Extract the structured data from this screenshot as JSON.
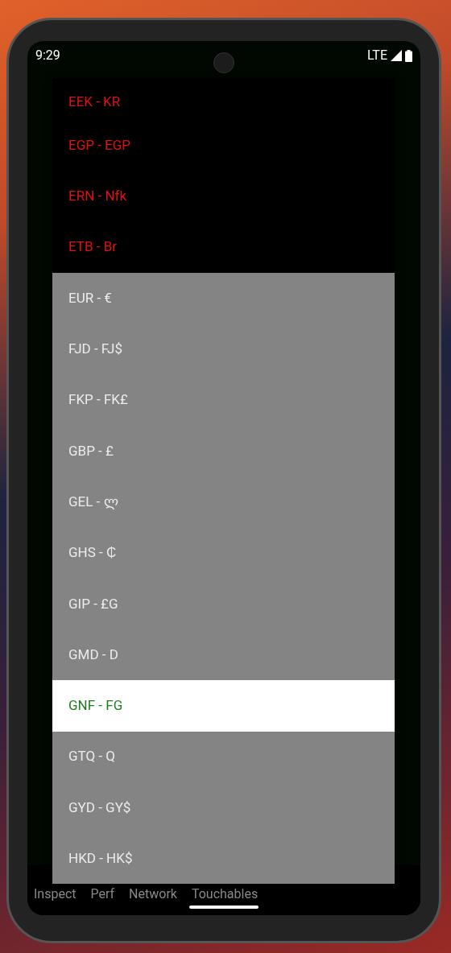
{
  "status_bar": {
    "time": "9:29",
    "network": "LTE"
  },
  "dropdown": {
    "items": [
      {
        "label": "EEK - KR",
        "kind": "unavailable",
        "selected": false
      },
      {
        "label": "EGP - EGP",
        "kind": "unavailable",
        "selected": false
      },
      {
        "label": "ERN - Nfk",
        "kind": "unavailable",
        "selected": false
      },
      {
        "label": "ETB - Br",
        "kind": "unavailable",
        "selected": false
      },
      {
        "label": "EUR - €",
        "kind": "option",
        "selected": false
      },
      {
        "label": "FJD - FJ$",
        "kind": "option",
        "selected": false
      },
      {
        "label": "FKP - FK£",
        "kind": "option",
        "selected": false
      },
      {
        "label": "GBP - £",
        "kind": "option",
        "selected": false
      },
      {
        "label": "GEL - ლ",
        "kind": "option",
        "selected": false
      },
      {
        "label": "GHS - ₵",
        "kind": "option",
        "selected": false
      },
      {
        "label": "GIP - £G",
        "kind": "option",
        "selected": false
      },
      {
        "label": "GMD - D",
        "kind": "option",
        "selected": false
      },
      {
        "label": "GNF - FG",
        "kind": "option",
        "selected": true
      },
      {
        "label": "GTQ - Q",
        "kind": "option",
        "selected": false
      },
      {
        "label": "GYD - GY$",
        "kind": "option",
        "selected": false
      },
      {
        "label": "HKD - HK$",
        "kind": "option",
        "selected": false
      }
    ]
  },
  "bottom_tabs": [
    "Inspect",
    "Perf",
    "Network",
    "Touchables"
  ]
}
